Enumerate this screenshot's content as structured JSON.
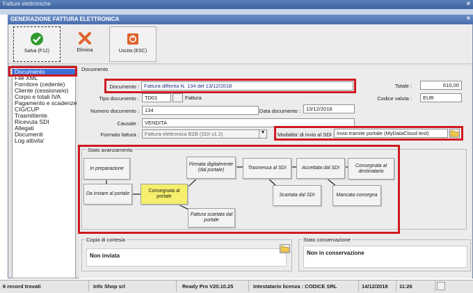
{
  "outer_window": {
    "title": "Fatture elettroniche",
    "close": "×"
  },
  "dialog": {
    "title": "GENERAZIONE FATTURA ELETTRONICA",
    "close": "×"
  },
  "toolbar": {
    "save": "Salva (F12)",
    "delete": "Elimina",
    "exit": "Uscita (ESC)"
  },
  "sidebar": {
    "items": [
      "Documento",
      "File XML",
      "Fornitore (cedente)",
      "Cliente (cessionario)",
      "Corpo e totali IVA",
      "Pagamento e scadenze",
      "CIG/CUP",
      "Trasmittente",
      "Ricevuta SDI",
      "Allegati",
      "Documenti",
      "Log attivita'"
    ]
  },
  "document_section": {
    "title": "Documento",
    "documento_label": "Documento :",
    "documento_value": "Fattura differita N. 134 del 13/12/2018",
    "tipo_label": "Tipo documento :",
    "tipo_code": "TD01",
    "tipo_desc": "Fattura",
    "numero_label": "Numero documento :",
    "numero_value": "134",
    "data_label": "Data documento :",
    "data_value": "13/12/2018",
    "causale_label": "Causale :",
    "causale_value": "VENDITA",
    "formato_label": "Formato fattura :",
    "formato_value": "Fattura elettronica B2B (SDI v1.2)",
    "totale_label": "Totale :",
    "totale_value": "610,00",
    "valuta_label": "Codice valuta :",
    "valuta_value": "EUR",
    "modalita_label": "Modalita' di invio al SDI :",
    "modalita_value": "Invio tramite portale (MyDataCloud test)"
  },
  "stato_avanzamento": {
    "title": "Stato avanzamento",
    "nodes": {
      "in_preparazione": "In preparazione",
      "da_inviare": "Da inviare al portale",
      "consegnata_portale": "Consegnata al portale",
      "firmata": "Firmata digitalmente (dal portale)",
      "scartata_portale": "Fattura scartata dal portale",
      "trasmessa": "Trasmessa al SDI",
      "scartata_sdi": "Scartata dal SDI",
      "accettata": "Accettata dal SDI",
      "mancata": "Mancata consegna",
      "consegnata_dest": "Consegnata al destinatario"
    }
  },
  "copia_cortesia": {
    "title": "Copia di cortesia",
    "value": "Non inviata"
  },
  "stato_conservazione": {
    "title": "Stato conservazione",
    "value": "Non in conservazione"
  },
  "statusbar": {
    "records": "6 record trovati",
    "company": "Info Shop srl",
    "version": "Ready Pro V20.10.25",
    "license": "Intestatario licenza : CODICE SRL",
    "date": "14/12/2018",
    "time": "11:26"
  }
}
